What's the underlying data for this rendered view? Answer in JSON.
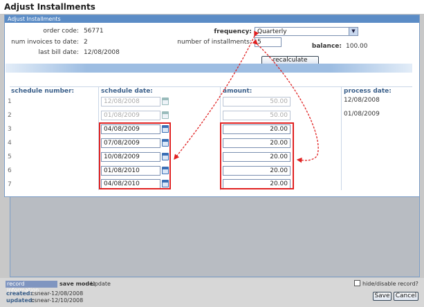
{
  "window": {
    "title": "Adjust Installments"
  },
  "panel": {
    "header": "Adjust Installments"
  },
  "info": {
    "order_code_label": "order code:",
    "order_code": "56771",
    "num_invoices_label": "num invoices to date:",
    "num_invoices": "2",
    "last_bill_label": "last bill date:",
    "last_bill": "12/08/2008"
  },
  "controls": {
    "frequency_label": "frequency:",
    "frequency_value": "Quarterly",
    "installments_label": "number of installments:",
    "installments_value": "5",
    "balance_label": "balance:",
    "balance_value": "100.00",
    "recalculate_label": "recalculate"
  },
  "table": {
    "headers": {
      "schedule_number": "schedule number:",
      "schedule_date": "schedule date:",
      "amount": "amount:",
      "process_date": "process date:"
    },
    "rows": [
      {
        "num": "1",
        "date": "12/08/2008",
        "amount": "50.00",
        "process": "12/08/2008"
      },
      {
        "num": "2",
        "date": "01/08/2009",
        "amount": "50.00",
        "process": "01/08/2009"
      },
      {
        "num": "3",
        "date": "04/08/2009",
        "amount": "20.00",
        "process": ""
      },
      {
        "num": "4",
        "date": "07/08/2009",
        "amount": "20.00",
        "process": ""
      },
      {
        "num": "5",
        "date": "10/08/2009",
        "amount": "20.00",
        "process": ""
      },
      {
        "num": "6",
        "date": "01/08/2010",
        "amount": "20.00",
        "process": ""
      },
      {
        "num": "7",
        "date": "04/08/2010",
        "amount": "20.00",
        "process": ""
      }
    ]
  },
  "footer": {
    "record_info_label": "record information",
    "save_mode_label": "save mode:",
    "save_mode_value": "Update",
    "hide_label": "hide/disable record?",
    "created_label": "created:",
    "created_value": "csnear-12/08/2008",
    "updated_label": "updated:",
    "updated_value": "csnear-12/10/2008",
    "save_label": "Save",
    "cancel_label": "Cancel"
  },
  "colors": {
    "accent": "#5b8cc6",
    "highlight": "#e02020"
  }
}
